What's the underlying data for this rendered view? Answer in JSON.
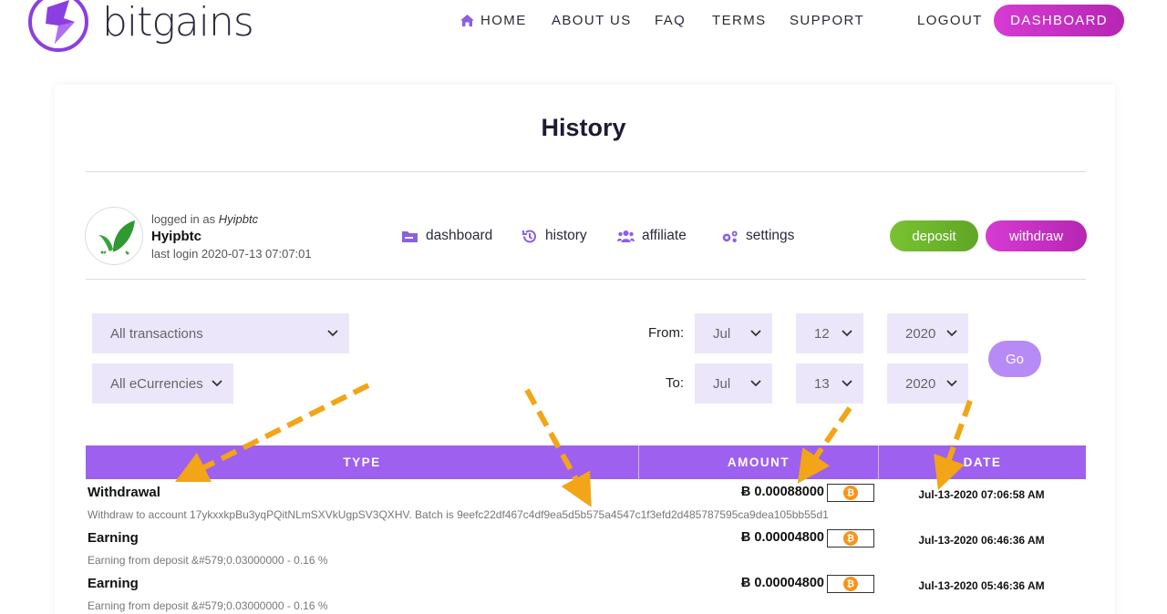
{
  "brand": {
    "name": "bitgains"
  },
  "nav": {
    "home": "HOME",
    "about": "ABOUT US",
    "faq": "FAQ",
    "terms": "TERMS",
    "support": "SUPPORT",
    "logout": "LOGOUT",
    "dashboard": "DASHBOARD"
  },
  "page": {
    "title": "History"
  },
  "user": {
    "logged_in_prefix": "logged in as",
    "logged_in_name": "Hyipbtc",
    "username": "Hyipbtc",
    "last_login": "last login 2020-07-13 07:07:01"
  },
  "user_menu": {
    "dashboard": "dashboard",
    "history": "history",
    "affiliate": "affiliate",
    "settings": "settings",
    "deposit": "deposit",
    "withdraw": "withdraw"
  },
  "filters": {
    "type_selected": "All transactions",
    "currency_selected": "All eCurrencies",
    "from_label": "From:",
    "to_label": "To:",
    "from": {
      "month": "Jul",
      "day": "12",
      "year": "2020"
    },
    "to": {
      "month": "Jul",
      "day": "13",
      "year": "2020"
    },
    "go": "Go"
  },
  "table": {
    "headers": {
      "type": "TYPE",
      "amount": "AMOUNT",
      "date": "DATE"
    },
    "rows": [
      {
        "type": "Withdrawal",
        "desc": "Withdraw to account 17ykxxkpBu3yqPQitNLmSXVkUgpSV3QXHV. Batch is 9eefc22df467c4df9ea5d5b575a4547c1f3efd2d485787595ca9dea105bb55d1",
        "amount": "Ƀ 0.00088000",
        "date": "Jul-13-2020 07:06:58 AM"
      },
      {
        "type": "Earning",
        "desc": "Earning from deposit &#579;0.03000000 - 0.16 %",
        "amount": "Ƀ 0.00004800",
        "date": "Jul-13-2020 06:46:36 AM"
      },
      {
        "type": "Earning",
        "desc": "Earning from deposit &#579;0.03000000 - 0.16 %",
        "amount": "Ƀ 0.00004800",
        "date": "Jul-13-2020 05:46:36 AM"
      }
    ],
    "coin_icon": "bitcoin-icon"
  },
  "colors": {
    "purple_header": "#9e60ee",
    "magenta_button": "#c42fc1",
    "green_button": "#6cb52b",
    "select_bg": "#ece6fb",
    "arrow": "#f2a516"
  }
}
